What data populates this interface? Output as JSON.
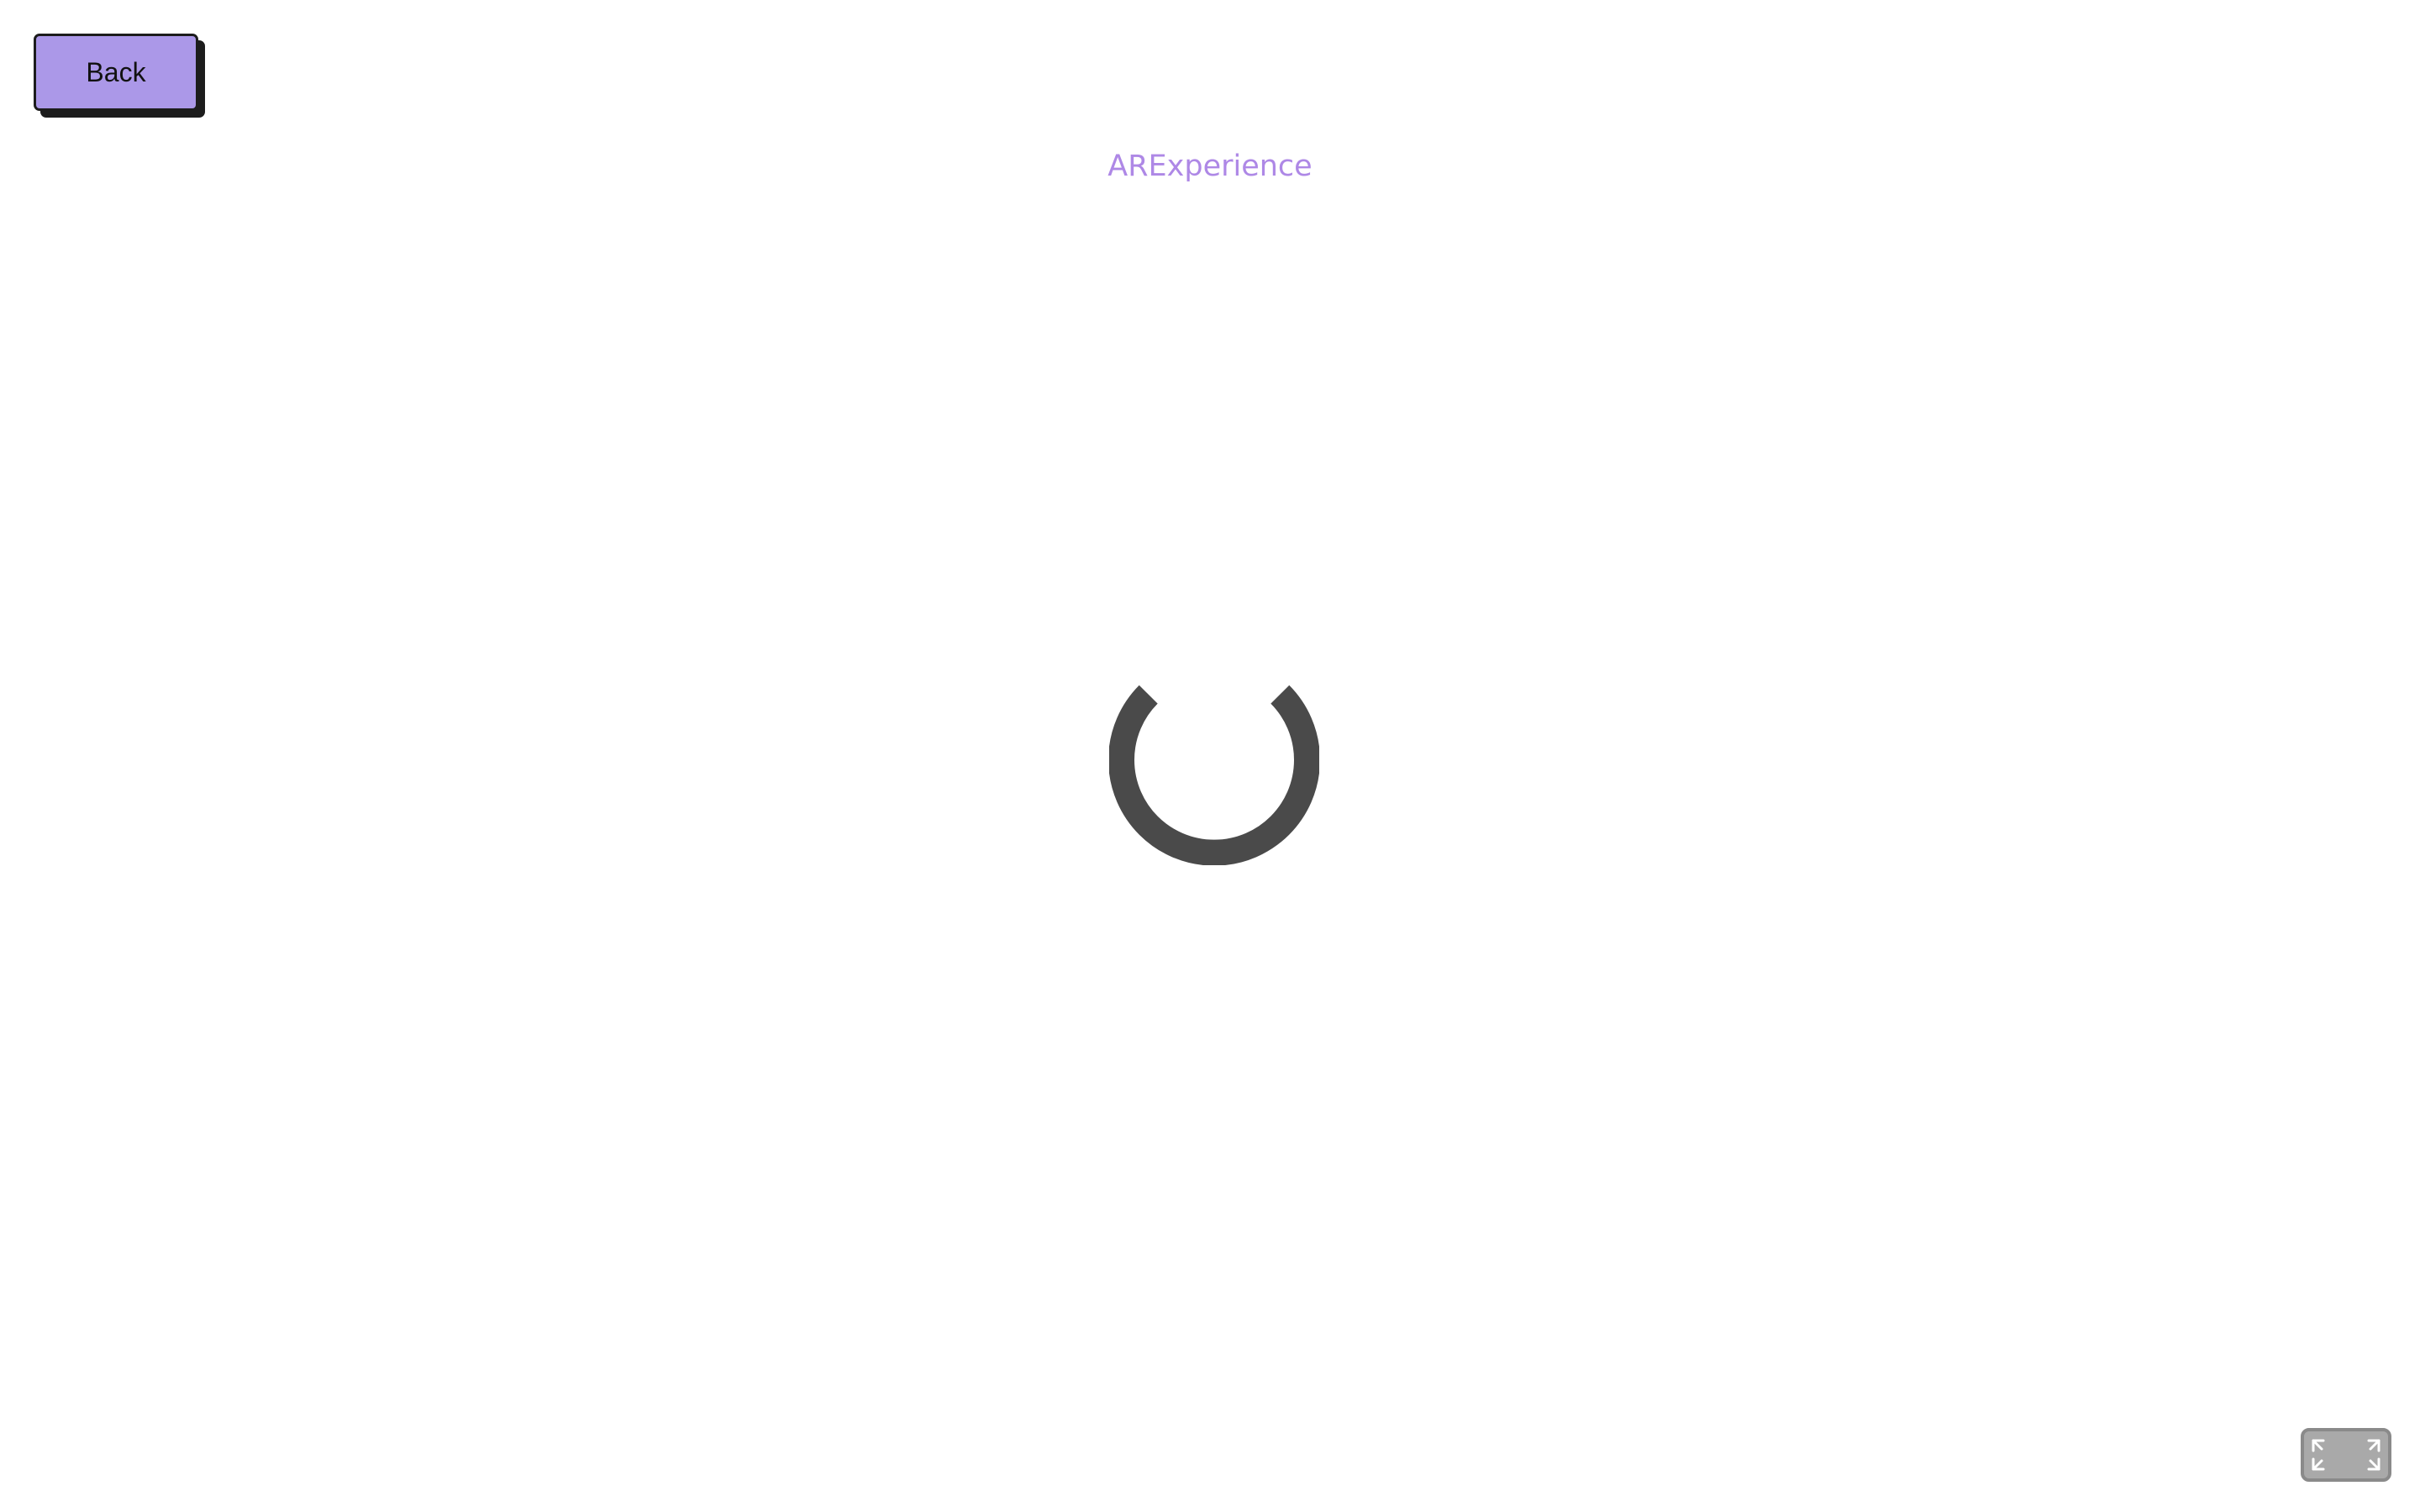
{
  "header": {
    "back_label": "Back",
    "title": "ARExperience"
  },
  "loading": {
    "icon": "loading-spinner-icon"
  },
  "controls": {
    "fullscreen_icon": "fullscreen-icon"
  },
  "colors": {
    "accent": "#ab98e8",
    "title": "#ae88e6",
    "spinner": "#4a4a4a",
    "fullscreen_bg": "#a9a9a9"
  }
}
